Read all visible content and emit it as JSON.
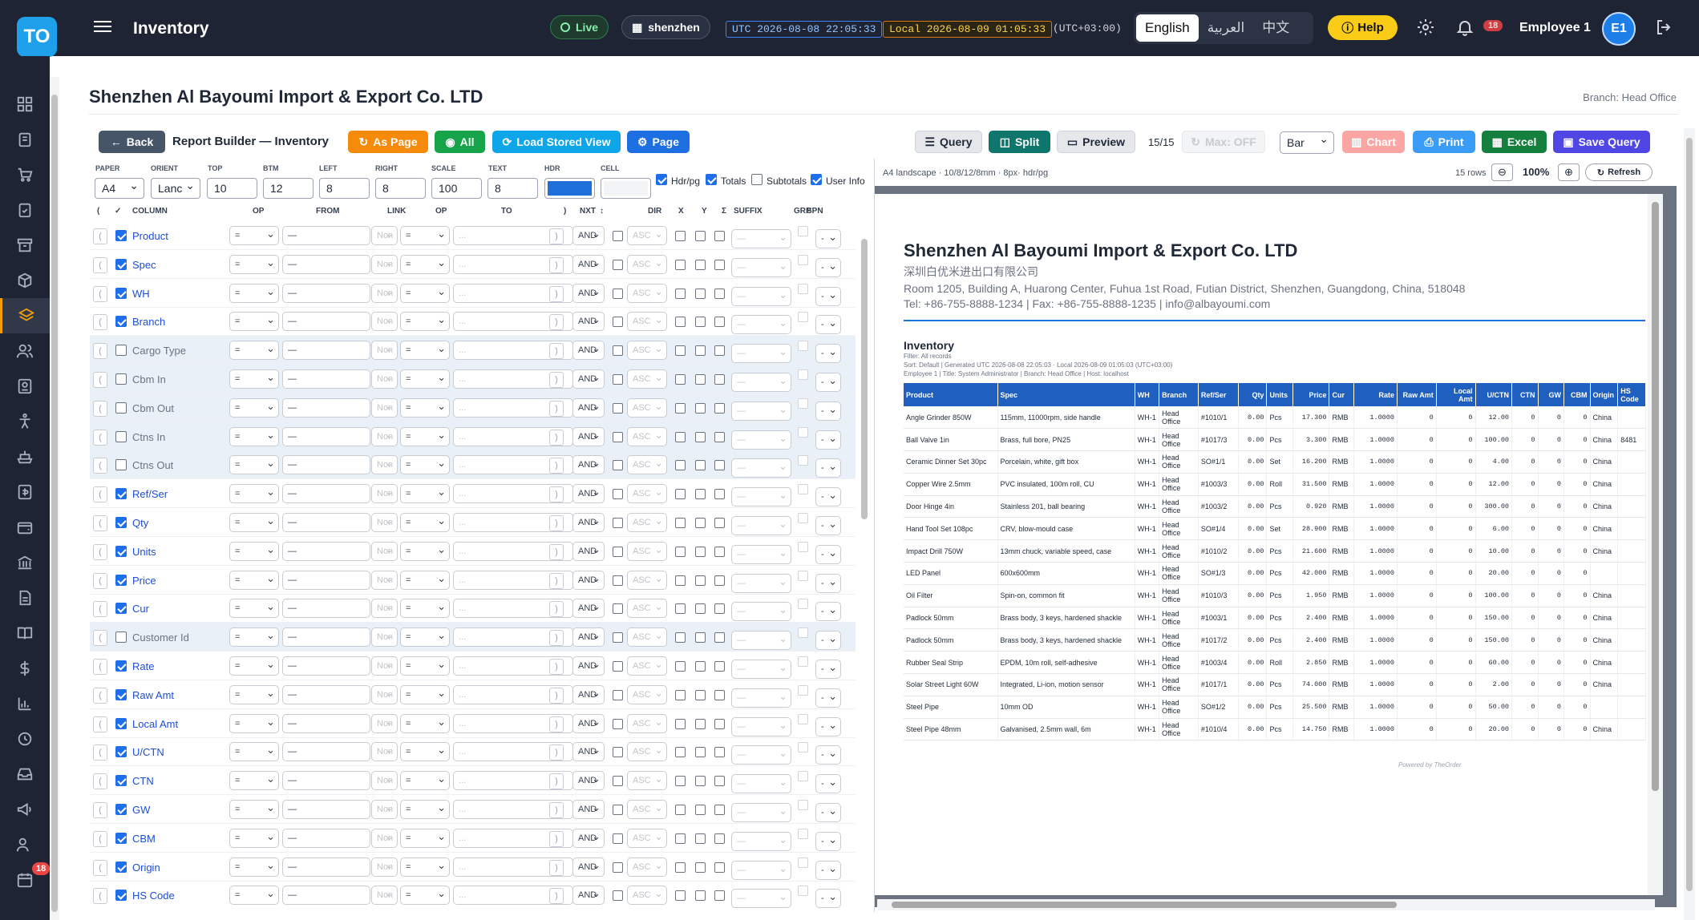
{
  "app": {
    "logo": "TO",
    "title": "Inventory",
    "live": "Live",
    "location": "shenzhen",
    "utc": "UTC 2026-08-08 22:05:33",
    "local": "Local 2026-08-09 01:05:33",
    "tz": "(UTC+03:00)",
    "langs": [
      "English",
      "العربية",
      "中文"
    ],
    "help": "Help",
    "notif_count": "18",
    "employee": "Employee 1",
    "avatar": "E1",
    "side_badge": "18"
  },
  "page": {
    "company": "Shenzhen Al Bayoumi Import & Export Co. LTD",
    "branch": "Branch: Head Office"
  },
  "toolbar": {
    "back": "Back",
    "title": "Report Builder — Inventory",
    "as_page": "As Page",
    "all": "All",
    "load": "Load Stored View",
    "page": "Page",
    "query": "Query",
    "split": "Split",
    "preview": "Preview",
    "count": "15/15",
    "max": "Max: OFF",
    "chart_type": "Bar",
    "chart": "Chart",
    "print": "Print",
    "excel": "Excel",
    "save": "Save Query"
  },
  "settings": {
    "paper_l": "PAPER",
    "paper": "A4",
    "orient_l": "ORIENT",
    "orient": "Lanc",
    "top_l": "TOP",
    "top": "10",
    "btm_l": "BTM",
    "btm": "12",
    "left_l": "LEFT",
    "left": "8",
    "right_l": "RIGHT",
    "right": "8",
    "scale_l": "SCALE",
    "scale": "100",
    "text_l": "TEXT",
    "text": "8",
    "hdr_l": "HDR",
    "cell_l": "CELL",
    "hdrpg": "Hdr/pg",
    "totals": "Totals",
    "subtotals": "Subtotals",
    "userinfo": "User Info",
    "hdr_color": "#1e6fd9",
    "cell_color": "#f3f4f6"
  },
  "headers": [
    "(",
    "✓",
    "COLUMN",
    "OP",
    "FROM",
    "LINK",
    "OP",
    "TO",
    ")",
    "NXT",
    "↕",
    "DIR",
    "X",
    "Y",
    "Σ",
    "SUFFIX",
    "GRP",
    "SPN"
  ],
  "columns": [
    {
      "name": "Product",
      "on": true
    },
    {
      "name": "Spec",
      "on": true
    },
    {
      "name": "WH",
      "on": true
    },
    {
      "name": "Branch",
      "on": true
    },
    {
      "name": "Cargo Type",
      "on": false
    },
    {
      "name": "Cbm In",
      "on": false
    },
    {
      "name": "Cbm Out",
      "on": false
    },
    {
      "name": "Ctns In",
      "on": false
    },
    {
      "name": "Ctns Out",
      "on": false
    },
    {
      "name": "Ref/Ser",
      "on": true
    },
    {
      "name": "Qty",
      "on": true
    },
    {
      "name": "Units",
      "on": true
    },
    {
      "name": "Price",
      "on": true
    },
    {
      "name": "Cur",
      "on": true
    },
    {
      "name": "Customer Id",
      "on": false
    },
    {
      "name": "Rate",
      "on": true
    },
    {
      "name": "Raw Amt",
      "on": true
    },
    {
      "name": "Local Amt",
      "on": true
    },
    {
      "name": "U/CTN",
      "on": true
    },
    {
      "name": "CTN",
      "on": true
    },
    {
      "name": "GW",
      "on": true
    },
    {
      "name": "CBM",
      "on": true
    },
    {
      "name": "Origin",
      "on": true
    },
    {
      "name": "HS Code",
      "on": true
    }
  ],
  "row_ctl": {
    "op": "=",
    "from": "—",
    "link": "Non",
    "op2": "=",
    "to": "...",
    "par_open": "(",
    "par_close": ")",
    "nxt": "AND",
    "dir": "ASC",
    "suffix": "—",
    "spn": "-"
  },
  "preview": {
    "info": "A4 landscape · 10/8/12/8mm · 8px· hdr/pg",
    "rows": "15 rows",
    "zoom": "100%",
    "refresh": "Refresh"
  },
  "doc": {
    "title": "Shenzhen Al Bayoumi Import & Export Co. LTD",
    "cn": "深圳白优米进出口有限公司",
    "addr": "Room 1205, Building A, Huarong Center, Fuhua 1st Road, Futian District, Shenzhen, Guangdong, China, 518048",
    "tel": "Tel: +86-755-8888-1234 | Fax: +86-755-8888-1235 | info@albayoumi.com",
    "report": "Inventory",
    "filter": "Filter: All records",
    "sort": "Sort: Default | Generated UTC 2026-08-08 22:05:03 · Local 2026-08-09 01:05:03 (UTC+03:00)",
    "user": "Employee 1 | Title: System Administrator | Branch: Head Office | Host: localhost",
    "powered": "Powered by TheOrder"
  },
  "table": {
    "headers": [
      "Product",
      "Spec",
      "WH",
      "Branch",
      "Ref/Ser",
      "Qty",
      "Units",
      "Price",
      "Cur",
      "Rate",
      "Raw Amt",
      "Local Amt",
      "U/CTN",
      "CTN",
      "GW",
      "CBM",
      "Origin",
      "HS Code"
    ],
    "rows": [
      [
        "Angle Grinder 850W",
        "115mm, 11000rpm, side handle",
        "WH-1",
        "Head Office",
        "#1010/1",
        "0.00",
        "Pcs",
        "17.300",
        "RMB",
        "1.0000",
        "0",
        "0",
        "12.00",
        "0",
        "0",
        "0",
        "China",
        ""
      ],
      [
        "Ball Valve 1in",
        "Brass, full bore, PN25",
        "WH-1",
        "Head Office",
        "#1017/3",
        "0.00",
        "Pcs",
        "3.300",
        "RMB",
        "1.0000",
        "0",
        "0",
        "100.00",
        "0",
        "0",
        "0",
        "China",
        "8481"
      ],
      [
        "Ceramic Dinner Set 30pc",
        "Porcelain, white, gift box",
        "WH-1",
        "Head Office",
        "SO#1/1",
        "0.00",
        "Set",
        "16.200",
        "RMB",
        "1.0000",
        "0",
        "0",
        "4.00",
        "0",
        "0",
        "0",
        "China",
        ""
      ],
      [
        "Copper Wire 2.5mm",
        "PVC insulated, 100m roll, CU",
        "WH-1",
        "Head Office",
        "#1003/3",
        "0.00",
        "Roll",
        "31.500",
        "RMB",
        "1.0000",
        "0",
        "0",
        "12.00",
        "0",
        "0",
        "0",
        "China",
        ""
      ],
      [
        "Door Hinge 4in",
        "Stainless 201, ball bearing",
        "WH-1",
        "Head Office",
        "#1003/2",
        "0.00",
        "Pcs",
        "0.920",
        "RMB",
        "1.0000",
        "0",
        "0",
        "300.00",
        "0",
        "0",
        "0",
        "China",
        ""
      ],
      [
        "Hand Tool Set 108pc",
        "CRV, blow-mould case",
        "WH-1",
        "Head Office",
        "SO#1/4",
        "0.00",
        "Set",
        "28.900",
        "RMB",
        "1.0000",
        "0",
        "0",
        "6.00",
        "0",
        "0",
        "0",
        "China",
        ""
      ],
      [
        "Impact Drill 750W",
        "13mm chuck, variable speed, case",
        "WH-1",
        "Head Office",
        "#1010/2",
        "0.00",
        "Pcs",
        "21.600",
        "RMB",
        "1.0000",
        "0",
        "0",
        "10.00",
        "0",
        "0",
        "0",
        "China",
        ""
      ],
      [
        "LED Panel",
        "600x600mm",
        "WH-1",
        "Head Office",
        "SO#1/3",
        "0.00",
        "Pcs",
        "42.000",
        "RMB",
        "1.0000",
        "0",
        "0",
        "20.00",
        "0",
        "0",
        "0",
        "",
        ""
      ],
      [
        "Oil Filter",
        "Spin-on, common fit",
        "WH-1",
        "Head Office",
        "#1010/3",
        "0.00",
        "Pcs",
        "1.950",
        "RMB",
        "1.0000",
        "0",
        "0",
        "100.00",
        "0",
        "0",
        "0",
        "China",
        ""
      ],
      [
        "Padlock 50mm",
        "Brass body, 3 keys, hardened shackle",
        "WH-1",
        "Head Office",
        "#1003/1",
        "0.00",
        "Pcs",
        "2.400",
        "RMB",
        "1.0000",
        "0",
        "0",
        "150.00",
        "0",
        "0",
        "0",
        "China",
        ""
      ],
      [
        "Padlock 50mm",
        "Brass body, 3 keys, hardened shackle",
        "WH-1",
        "Head Office",
        "#1017/2",
        "0.00",
        "Pcs",
        "2.400",
        "RMB",
        "1.0000",
        "0",
        "0",
        "150.00",
        "0",
        "0",
        "0",
        "China",
        ""
      ],
      [
        "Rubber Seal Strip",
        "EPDM, 10m roll, self-adhesive",
        "WH-1",
        "Head Office",
        "#1003/4",
        "0.00",
        "Roll",
        "2.850",
        "RMB",
        "1.0000",
        "0",
        "0",
        "60.00",
        "0",
        "0",
        "0",
        "China",
        ""
      ],
      [
        "Solar Street Light 60W",
        "Integrated, Li-ion, motion sensor",
        "WH-1",
        "Head Office",
        "#1017/1",
        "0.00",
        "Pcs",
        "74.000",
        "RMB",
        "1.0000",
        "0",
        "0",
        "2.00",
        "0",
        "0",
        "0",
        "China",
        ""
      ],
      [
        "Steel Pipe",
        "10mm OD",
        "WH-1",
        "Head Office",
        "SO#1/2",
        "0.00",
        "Pcs",
        "25.500",
        "RMB",
        "1.0000",
        "0",
        "0",
        "50.00",
        "0",
        "0",
        "0",
        "",
        ""
      ],
      [
        "Steel Pipe 48mm",
        "Galvanised, 2.5mm wall, 6m",
        "WH-1",
        "Head Office",
        "#1010/4",
        "0.00",
        "Pcs",
        "14.750",
        "RMB",
        "1.0000",
        "0",
        "0",
        "20.00",
        "0",
        "0",
        "0",
        "China",
        ""
      ]
    ]
  }
}
